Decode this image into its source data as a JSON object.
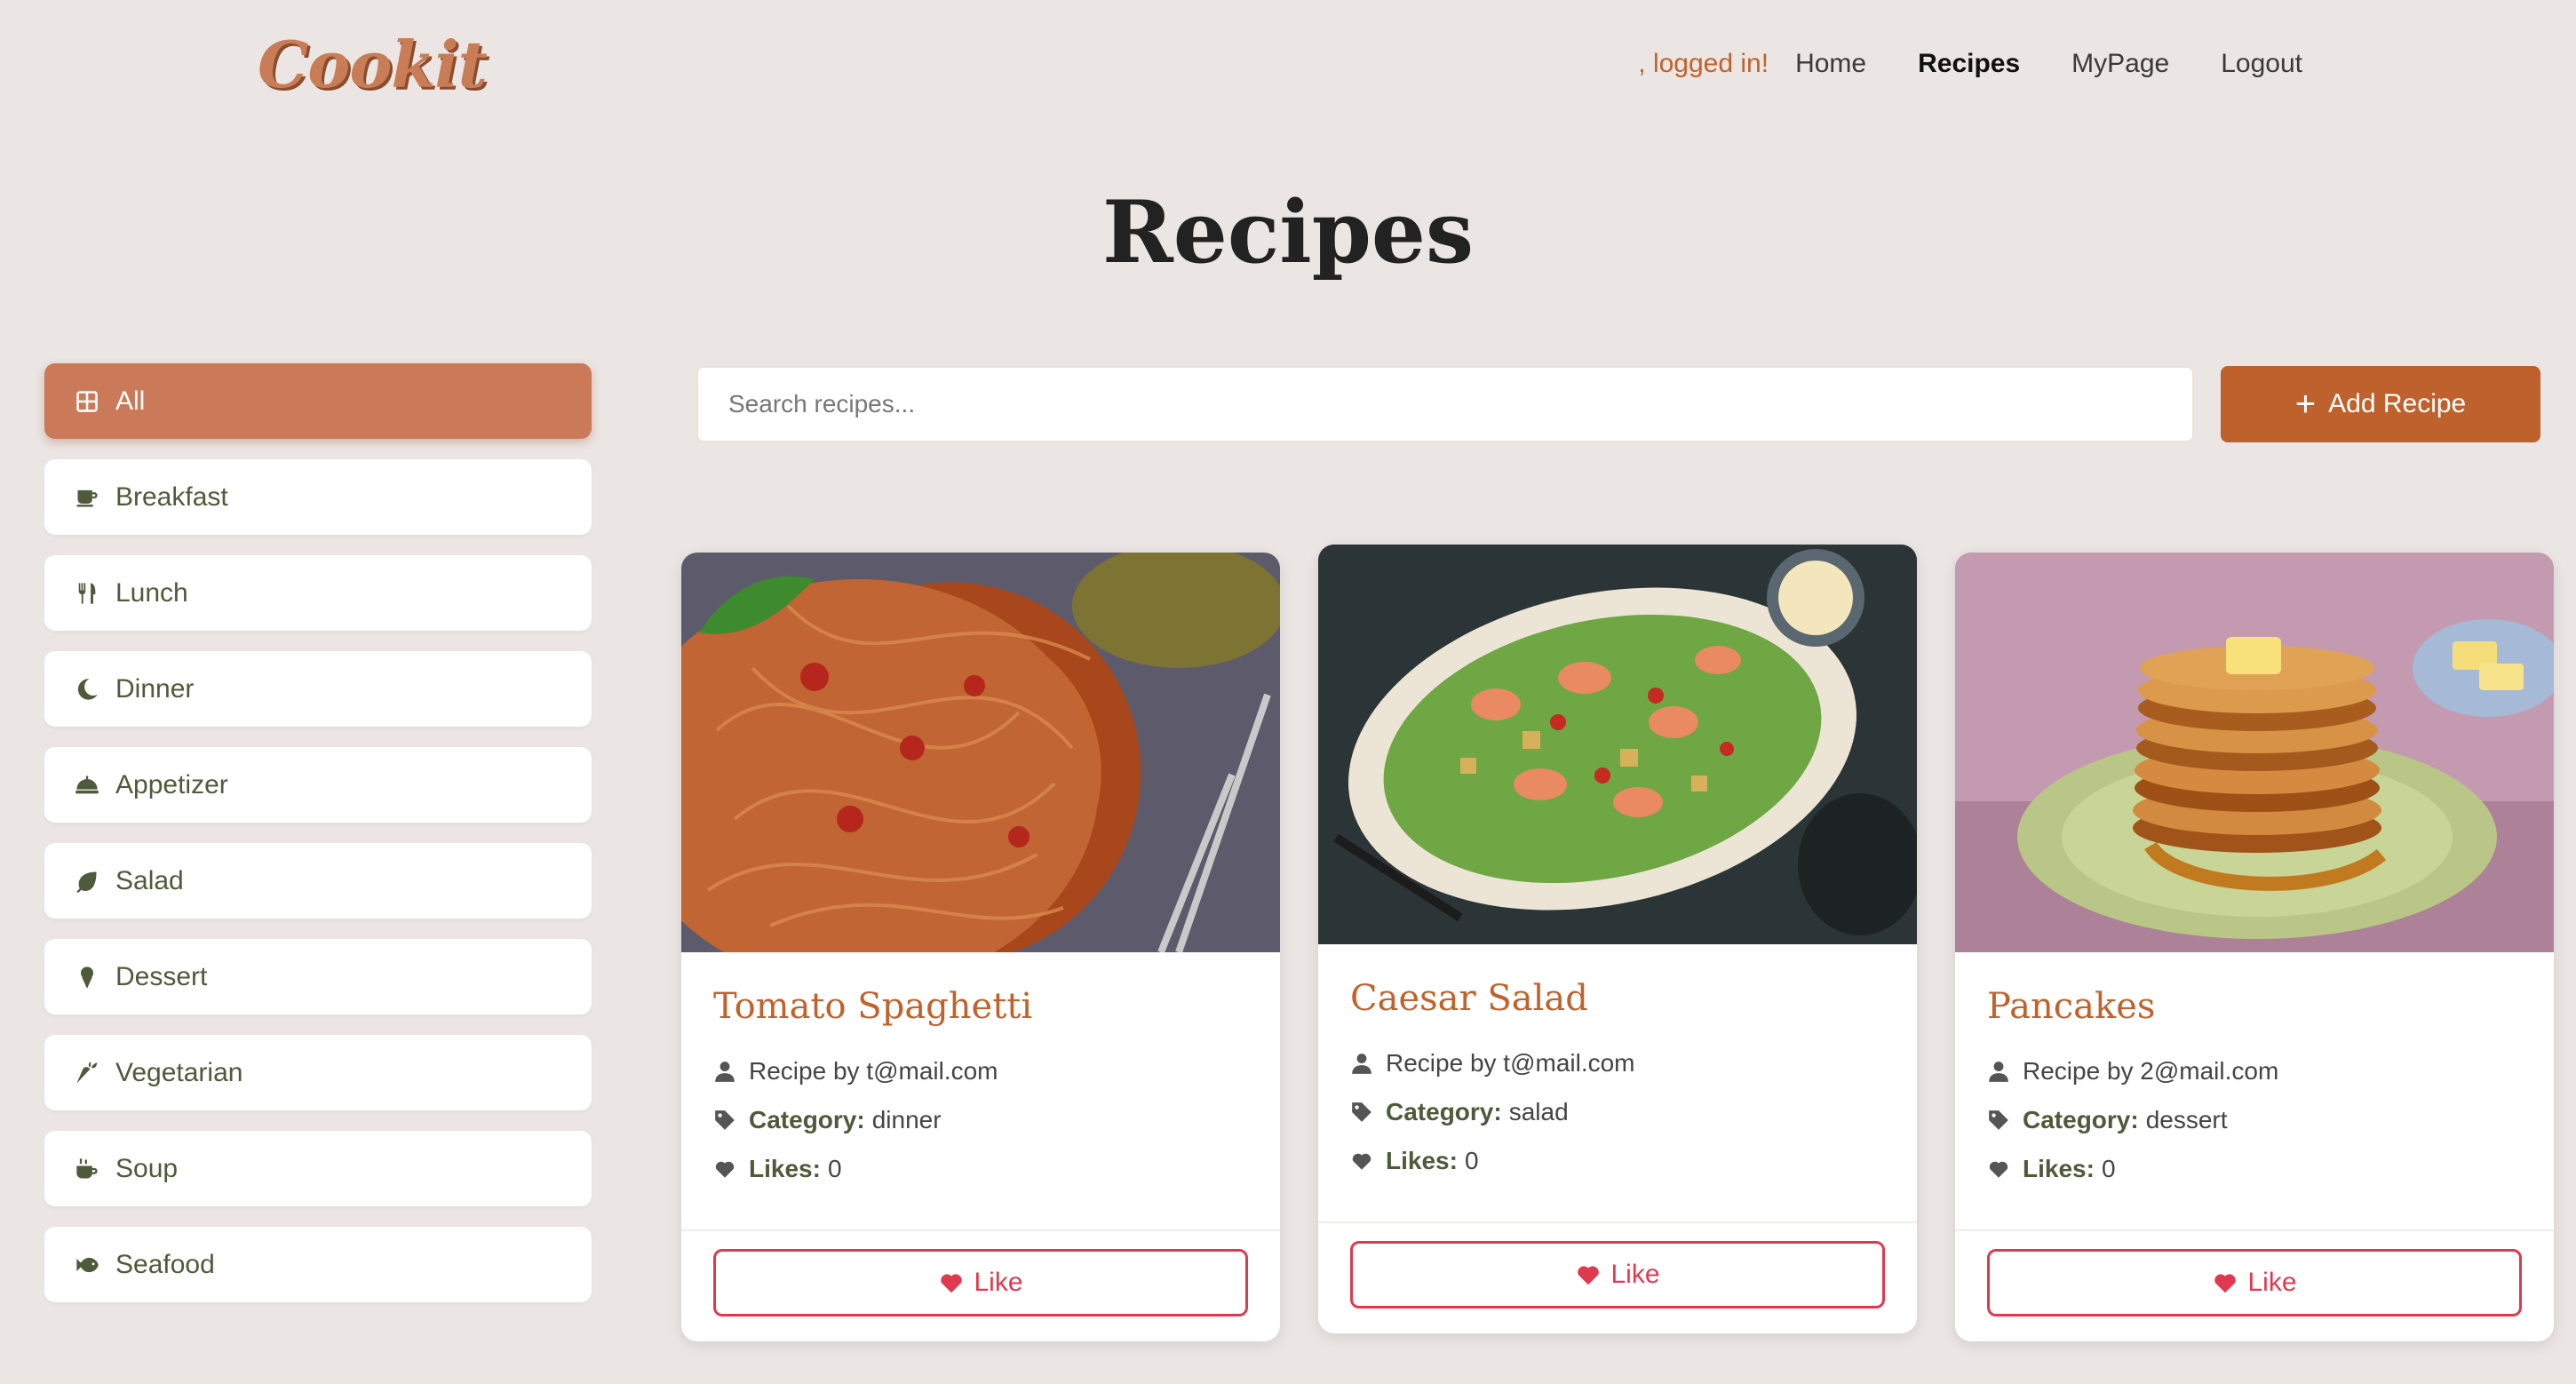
{
  "app": {
    "logo": "Cookit"
  },
  "nav": {
    "greeting": ", logged in!",
    "links": [
      "Home",
      "Recipes",
      "MyPage",
      "Logout"
    ],
    "active": "Recipes"
  },
  "page": {
    "title": "Recipes"
  },
  "sidebar": {
    "items": [
      {
        "label": "All",
        "icon": "grid-icon",
        "active": true
      },
      {
        "label": "Breakfast",
        "icon": "coffee-mug-icon"
      },
      {
        "label": "Lunch",
        "icon": "utensils-icon"
      },
      {
        "label": "Dinner",
        "icon": "moon-icon"
      },
      {
        "label": "Appetizer",
        "icon": "cloche-icon"
      },
      {
        "label": "Salad",
        "icon": "leaf-icon"
      },
      {
        "label": "Dessert",
        "icon": "ice-cream-icon"
      },
      {
        "label": "Vegetarian",
        "icon": "carrot-icon"
      },
      {
        "label": "Soup",
        "icon": "soup-mug-icon"
      },
      {
        "label": "Seafood",
        "icon": "fish-icon"
      }
    ]
  },
  "search": {
    "placeholder": "Search recipes..."
  },
  "toolbar": {
    "add_label": "Add Recipe"
  },
  "recipes": [
    {
      "title": "Tomato Spaghetti",
      "author": "Recipe by t@mail.com",
      "category_label": "Category:",
      "category": "dinner",
      "likes_label": "Likes:",
      "likes": "0",
      "like_button": "Like",
      "image": "spaghetti"
    },
    {
      "title": "Caesar Salad",
      "author": "Recipe by t@mail.com",
      "category_label": "Category:",
      "category": "salad",
      "likes_label": "Likes:",
      "likes": "0",
      "like_button": "Like",
      "image": "salad"
    },
    {
      "title": "Pancakes",
      "author": "Recipe by 2@mail.com",
      "category_label": "Category:",
      "category": "dessert",
      "likes_label": "Likes:",
      "likes": "0",
      "like_button": "Like",
      "image": "pancakes"
    }
  ],
  "colors": {
    "accent": "#bf612d",
    "active_category": "#cb7a59",
    "like": "#e0394f",
    "background": "#ebe5e3"
  }
}
